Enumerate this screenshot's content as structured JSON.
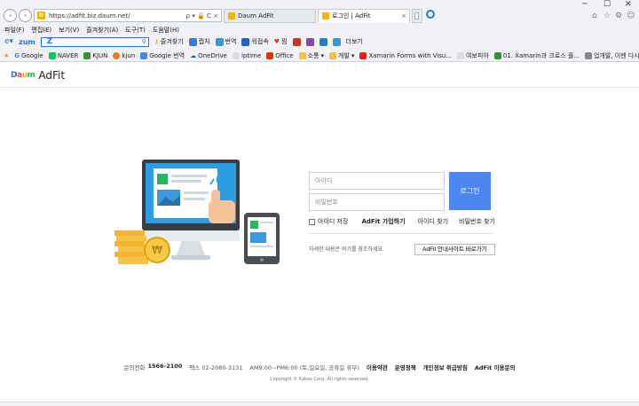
{
  "browser": {
    "url": "https://adfit.biz.daum.net/",
    "address_tools": "ρ ▾ 🔒 C ×",
    "tabs": [
      {
        "label": "Daum AdFit"
      },
      {
        "label": "로그인 | AdFit"
      }
    ],
    "menu": [
      "파일(F)",
      "편집(E)",
      "보기(V)",
      "즐겨찾기(A)",
      "도구(T)",
      "도움말(H)"
    ],
    "toolbar": {
      "zum": "zum",
      "search_letter": "Z",
      "items": [
        "즐겨찾기",
        "캡처",
        "번역",
        "워접속",
        "찜",
        "더보기"
      ]
    },
    "bookmarks": [
      "Google",
      "NAVER",
      "KJUN",
      "kjun",
      "Google 번역",
      "OneDrive",
      "iptime",
      "Office",
      "소통",
      "개발",
      "Xamarin Forms with Visu...",
      "여보피아",
      "01. Xamarin과 크로스 플...",
      "업개발, 이젠 다시 크로스..."
    ],
    "colors": {
      "accent": "#4c86f0"
    }
  },
  "site": {
    "logo_daum": "Daum",
    "logo_adfit": "AdFit"
  },
  "login": {
    "id_placeholder": "아이디",
    "pw_placeholder": "비밀번호",
    "login_label": "로그인",
    "save_id_label": "아이디 저장",
    "join_label": "AdFit 가입하기",
    "find_id_label": "아이디 찾기",
    "find_pw_label": "비밀번호 찾기",
    "guide_text": "자세한 내용은 여기를 참조하세요.",
    "guide_button": "AdFit 안내사이트 바로가기"
  },
  "footer": {
    "phone_label": "문의전화",
    "phone": "1566-2100",
    "fax": "팩스 02-2080-3131",
    "hours": "AM9:00~PM6:00 (토,일요일, 공휴일 휴무)",
    "links": [
      "이용약관",
      "운영정책",
      "개인정보 취급방침",
      "AdFit 이용문의"
    ],
    "copyright": "Copyright © Kakao Corp. All rights reserved."
  }
}
